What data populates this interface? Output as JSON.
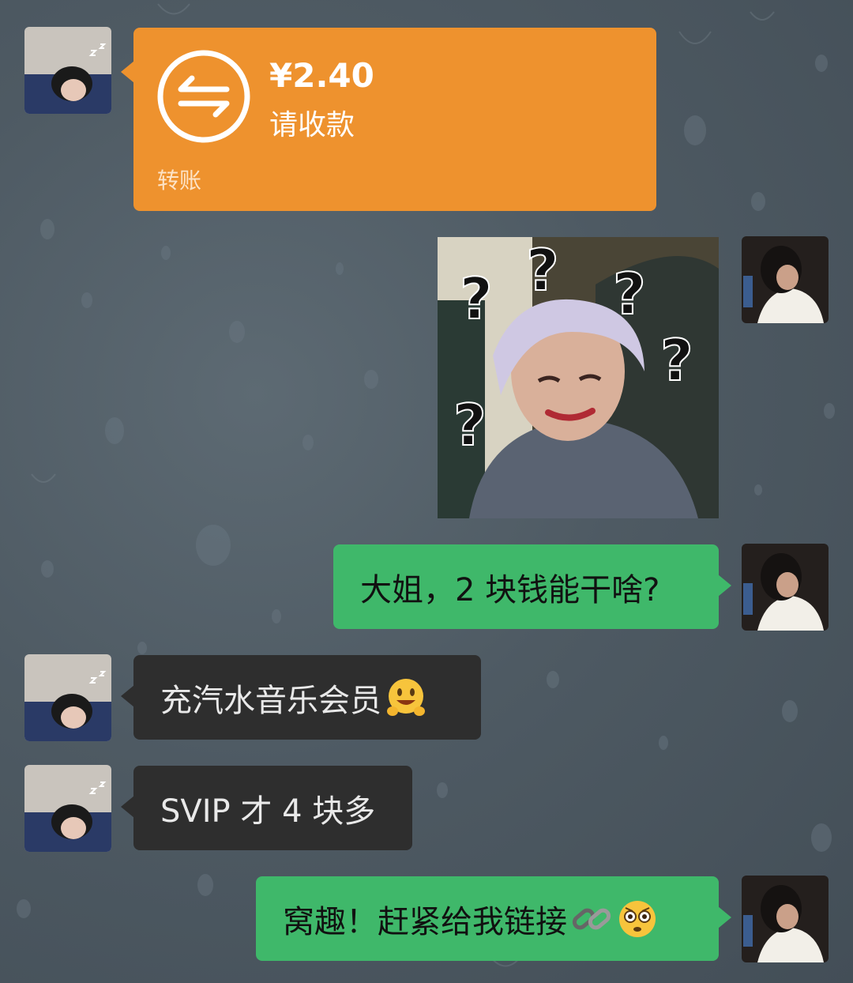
{
  "transfer": {
    "amount": "¥2.40",
    "status": "请收款",
    "label": "转账"
  },
  "messages": [
    {
      "side": "right",
      "text": "大姐，2 块钱能干啥?"
    },
    {
      "side": "left",
      "text": "充汽水音乐会员"
    },
    {
      "side": "left",
      "text": "SVIP 才 4 块多"
    },
    {
      "side": "right",
      "text": "窝趣！赶紧给我链接"
    }
  ],
  "sticker": {
    "marks": [
      "?",
      "?",
      "?",
      "?",
      "?"
    ]
  },
  "colors": {
    "transfer_bg": "#ee922e",
    "outgoing_bubble": "#3fb86a",
    "incoming_bubble": "#2e2e2e",
    "background": "#4e5a63"
  },
  "icons": [
    "transfer-arrows-icon",
    "smiling-emoji-icon",
    "link-icon",
    "flushed-emoji-icon"
  ]
}
